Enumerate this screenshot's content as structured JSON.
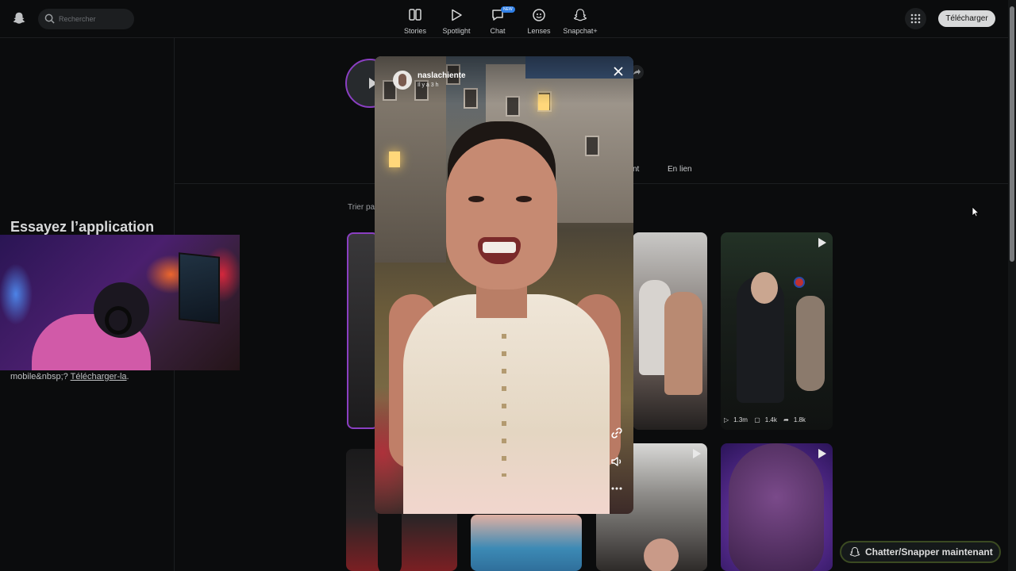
{
  "topbar": {
    "search_placeholder": "Rechercher",
    "nav": [
      {
        "label": "Stories",
        "icon": "stories-icon"
      },
      {
        "label": "Spotlight",
        "icon": "spotlight-play-icon"
      },
      {
        "label": "Chat",
        "icon": "chat-icon",
        "badge": "NEW"
      },
      {
        "label": "Lenses",
        "icon": "lenses-icon"
      },
      {
        "label": "Snapchat+",
        "icon": "snapchat-plus-icon"
      }
    ],
    "download_label": "Télécharger"
  },
  "left_panel": {
    "title": "Essayez l’application",
    "mobile_text_prefix": "mobile&nbsp;? ",
    "download_link": "Télécharger-la",
    "mobile_text_suffix": "."
  },
  "profile": {
    "tabs": [
      {
        "label": "nt"
      },
      {
        "label": "En lien"
      }
    ],
    "sort_label": "Trier pa"
  },
  "grid": {
    "featured_stats": {
      "views": "1.3m",
      "comments": "1.4k",
      "shares": "1.8k"
    }
  },
  "story": {
    "username": "naslachiente",
    "time_ago": "Il y a 3 h"
  },
  "chat_now_label": "Chatter/Snapper maintenant",
  "colors": {
    "background": "#0b0c0d",
    "accent_purple": "#8a3fc2",
    "chat_border": "#3b4a22"
  }
}
